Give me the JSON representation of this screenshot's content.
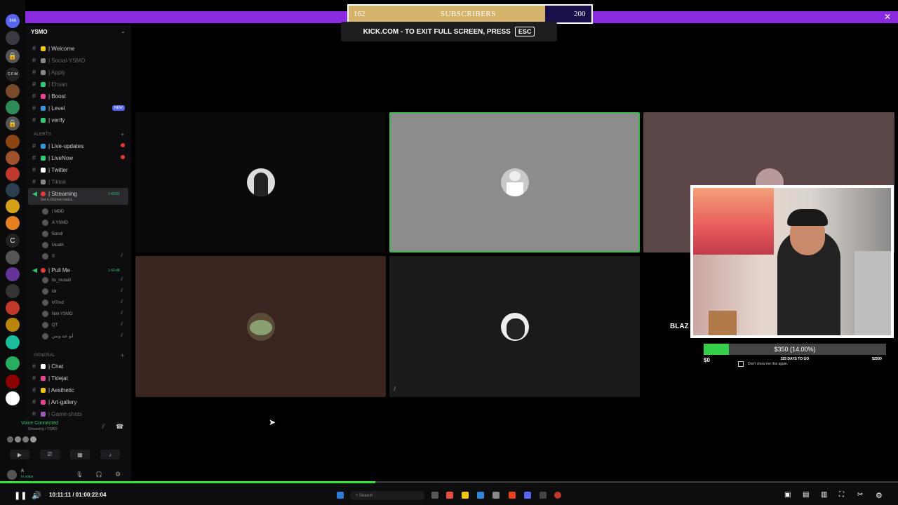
{
  "server": {
    "name": "YSMO"
  },
  "rail": {
    "badge": "348",
    "items": [
      "C-F-M",
      "C"
    ]
  },
  "channels": [
    {
      "label": "| Welcome",
      "color": "#f1c40f"
    },
    {
      "label": "| Social-YSMO",
      "color": "#888888"
    },
    {
      "label": "| Apply",
      "color": "#888888"
    },
    {
      "label": "| Ehsan",
      "color": "#2ecc71"
    },
    {
      "label": "| Boost",
      "color": "#e84393"
    },
    {
      "label": "| Level",
      "color": "#3498db"
    },
    {
      "label": "| verify",
      "color": "#2ecc71"
    }
  ],
  "new_badge": "NEW",
  "categories": {
    "alerts": "ALERTS",
    "general": "GENERAL"
  },
  "alert_channels": [
    {
      "label": "| Live-updates",
      "color": "#3498db"
    },
    {
      "label": "| LiveNow",
      "color": "#2ecc71"
    },
    {
      "label": "| Twitter",
      "color": "#ffffff"
    },
    {
      "label": "| Tiktok",
      "color": "#888888"
    }
  ],
  "voice_channels": [
    {
      "label": "| Streaming",
      "status": "Set a channel status",
      "time": "1:43:51",
      "users": [
        "| MOD",
        "A  YSMO",
        "Bandr",
        "Moath",
        "S"
      ]
    },
    {
      "label": "| Pull Me",
      "time": "1:42:48",
      "users": [
        "its_mutairi",
        "ldr",
        "M7md",
        "Nini  YSMO",
        "QT",
        "أبو عيد وبس"
      ]
    }
  ],
  "general_channels": [
    {
      "label": "| Chat",
      "color": "#ffffff"
    },
    {
      "label": "| Tklejat",
      "color": "#e84393"
    },
    {
      "label": "| Aesthetic",
      "color": "#f1c40f"
    },
    {
      "label": "| Art-gallery",
      "color": "#e84393"
    },
    {
      "label": "| Game-shots",
      "color": "#9b59b6"
    }
  ],
  "voice_panel": {
    "status": "Voice Connected",
    "channel": "Streaming / YSMO",
    "user": "A",
    "user_status": "In voice"
  },
  "subscribers": {
    "current": "162",
    "label": "SUBSCRIBERS",
    "goal": "200",
    "progress": 0.81
  },
  "fullscreen_notice": {
    "text": "KICK.COM - TO EXIT FULL SCREEN, PRESS",
    "key": "ESC"
  },
  "goal": {
    "text": "$350 (14.00%)",
    "start": "$0",
    "days": "325 DAYS TO GO",
    "end": "$2500",
    "dont_show": "Don't show me this again.",
    "progress": 0.14
  },
  "blaze_label": "BLAZ",
  "player": {
    "time": "10:11:11 / 01:00:22:04",
    "progress": 0.418,
    "search_placeholder": "Search"
  },
  "colors": {
    "accent": "#8a2be2",
    "progress": "#2ee62e",
    "tile_green": "#3fb950"
  }
}
